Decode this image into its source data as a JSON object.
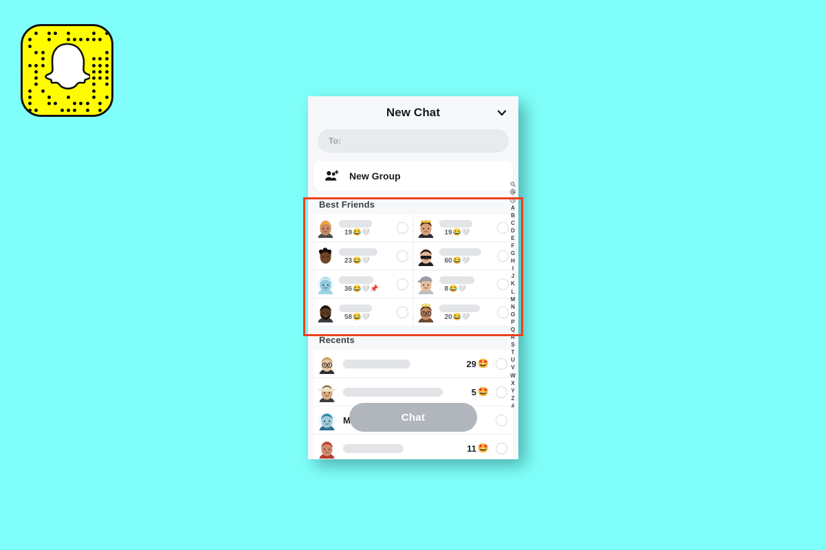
{
  "page": {
    "background_color": "#80fffa",
    "annotation_box_color": "#ee3f1c"
  },
  "logo": {
    "name": "snapchat-snapcode",
    "background_color": "#fffc00",
    "ghost_color": "#ffffff",
    "border_color": "#111111"
  },
  "phone": {
    "header": {
      "title": "New Chat",
      "collapse_icon": "chevron-down-icon"
    },
    "to_field": {
      "label": "To:",
      "value": "",
      "placeholder": "To:"
    },
    "new_group": {
      "label": "New Group",
      "icon": "group-add-icon"
    },
    "best_friends": {
      "title": "Best Friends",
      "items": [
        {
          "name": "",
          "streak": "19",
          "emojis": "😂🤍",
          "selected": false,
          "avatar": "bitmoji-orange-hair"
        },
        {
          "name": "",
          "streak": "19",
          "emojis": "😂🤍",
          "selected": false,
          "avatar": "bitmoji-crown"
        },
        {
          "name": "",
          "streak": "23",
          "emojis": "😂🤍",
          "selected": false,
          "avatar": "bitmoji-curly-hair"
        },
        {
          "name": "",
          "streak": "60",
          "emojis": "😂🤍",
          "selected": false,
          "avatar": "bitmoji-sunglasses"
        },
        {
          "name": "",
          "streak": "36",
          "emojis": "😂🤍📌",
          "selected": false,
          "avatar": "bitmoji-blue-face"
        },
        {
          "name": "",
          "streak": "8",
          "emojis": "😂🤍",
          "selected": false,
          "avatar": "bitmoji-backwards-cap"
        },
        {
          "name": "",
          "streak": "58",
          "emojis": "😂🤍",
          "selected": false,
          "avatar": "bitmoji-beard"
        },
        {
          "name": "",
          "streak": "20",
          "emojis": "😂🤍",
          "selected": false,
          "avatar": "bitmoji-halo-glasses"
        }
      ]
    },
    "recents": {
      "title": "Recents",
      "items": [
        {
          "name": "",
          "streak": "29",
          "emoji": "🤩",
          "selected": false,
          "avatar": "bitmoji-blond-glasses",
          "bar_width": "58%"
        },
        {
          "name": "",
          "streak": "5",
          "emoji": "🤩",
          "selected": false,
          "avatar": "bitmoji-cowboy-hat",
          "bar_width": "82%"
        },
        {
          "name": "M",
          "streak": "",
          "emoji": "",
          "selected": false,
          "avatar": "bitmoji-blue-hair",
          "bar_width": "0%"
        },
        {
          "name": "",
          "streak": "11",
          "emoji": "🤩",
          "selected": false,
          "avatar": "bitmoji-red-hair",
          "bar_width": "52%"
        }
      ]
    },
    "chat_button": {
      "label": "Chat"
    },
    "alpha_index": {
      "icons": [
        "search-icon",
        "at-icon",
        "clock-icon"
      ],
      "letters": [
        "A",
        "B",
        "C",
        "D",
        "E",
        "F",
        "G",
        "H",
        "I",
        "J",
        "K",
        "L",
        "M",
        "N",
        "O",
        "P",
        "Q",
        "R",
        "S",
        "T",
        "U",
        "V",
        "W",
        "X",
        "Y",
        "Z",
        "#"
      ]
    }
  }
}
